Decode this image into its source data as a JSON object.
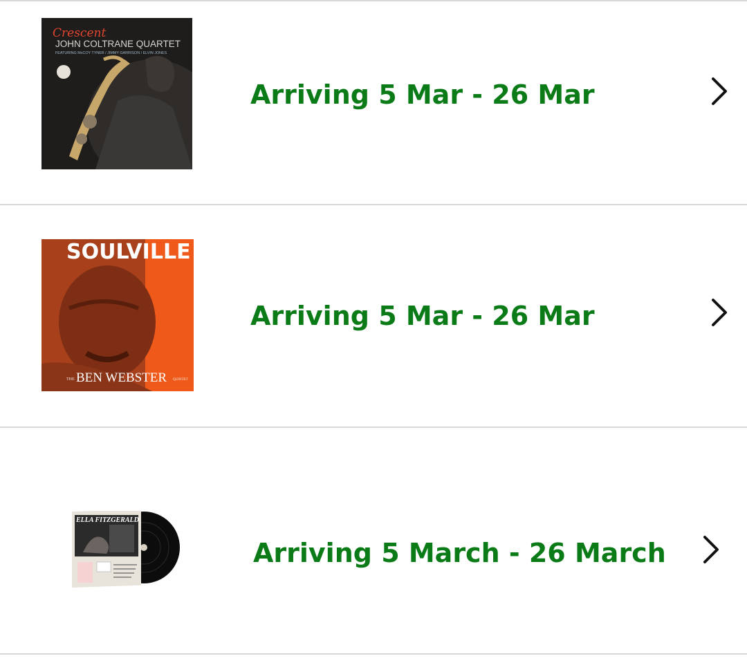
{
  "colors": {
    "status": "#0a7b16",
    "divider": "#d5d9d9",
    "chevron": "#111111"
  },
  "items": [
    {
      "status": "Arriving 5 Mar - 26 Mar",
      "cover": {
        "script_title": "Crescent",
        "artist": "JOHN COLTRANE QUARTET",
        "credits": "FEATURING McCOY TYNER / JIMMY GARRISON / ELVIN JONES",
        "icon": "album-cover-saxophonist"
      },
      "chevron_icon": "chevron-right-icon"
    },
    {
      "status": "Arriving 5 Mar - 26 Mar",
      "cover": {
        "title": "SOULVILLE",
        "artist_prefix": "THE",
        "artist": "BEN WEBSTER",
        "artist_suffix": "QUINTET",
        "icon": "album-cover-portrait"
      },
      "chevron_icon": "chevron-right-icon"
    },
    {
      "status": "Arriving 5 March - 26 March",
      "cover": {
        "title": "ELLA FITZGERALD",
        "icon": "vinyl-record-with-sleeve"
      },
      "chevron_icon": "chevron-right-icon"
    }
  ]
}
